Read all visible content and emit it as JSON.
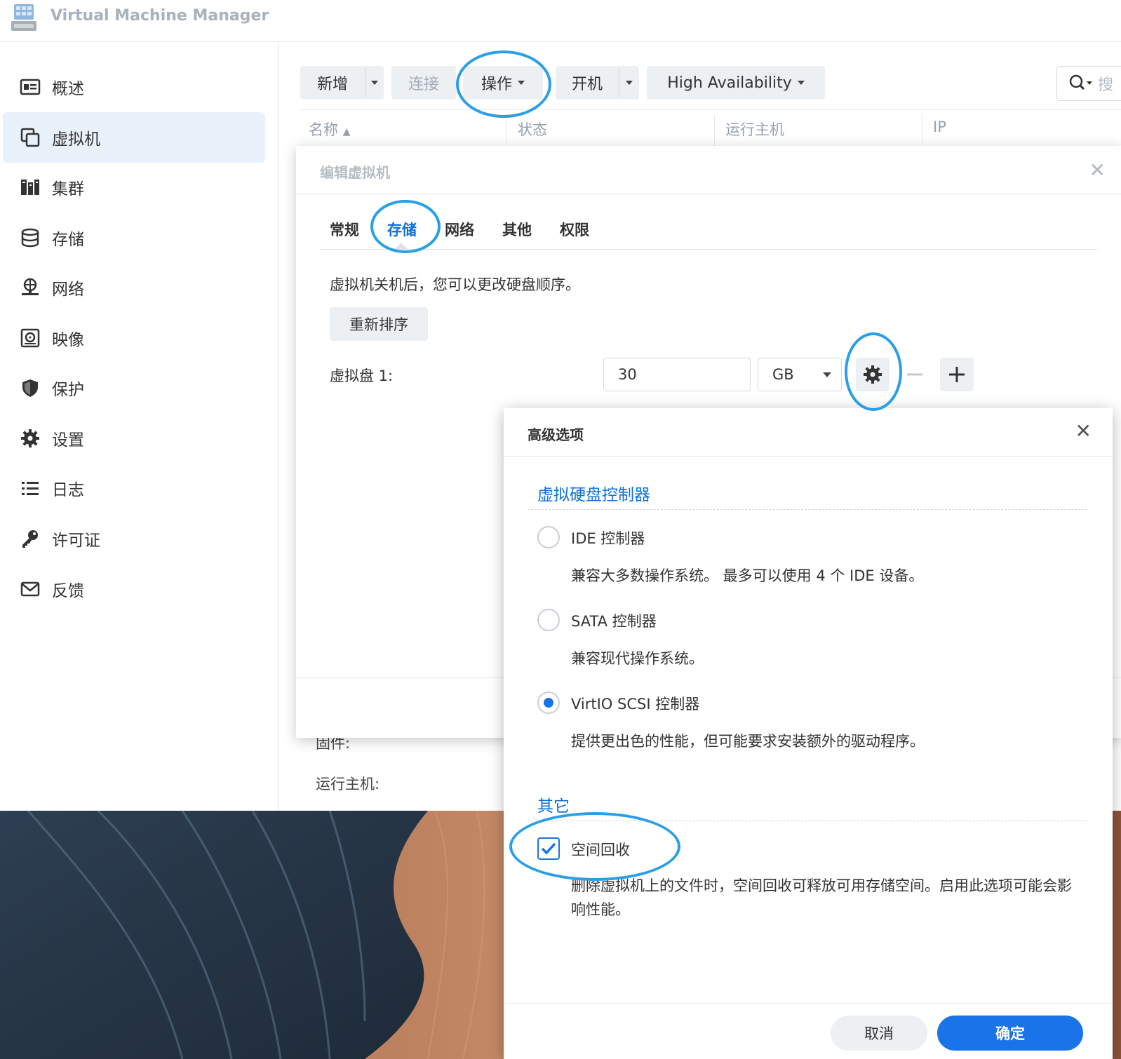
{
  "app": {
    "title": "Virtual Machine Manager"
  },
  "sidebar": {
    "items": [
      {
        "label": "概述",
        "icon": "overview-icon"
      },
      {
        "label": "虚拟机",
        "icon": "vm-icon",
        "active": true
      },
      {
        "label": "集群",
        "icon": "cluster-icon"
      },
      {
        "label": "存储",
        "icon": "storage-icon"
      },
      {
        "label": "网络",
        "icon": "network-icon"
      },
      {
        "label": "映像",
        "icon": "image-icon"
      },
      {
        "label": "保护",
        "icon": "shield-icon"
      },
      {
        "label": "设置",
        "icon": "gear-icon"
      },
      {
        "label": "日志",
        "icon": "log-icon"
      },
      {
        "label": "许可证",
        "icon": "key-icon"
      },
      {
        "label": "反馈",
        "icon": "mail-icon"
      }
    ]
  },
  "toolbar": {
    "create": "新增",
    "connect": "连接",
    "action": "操作",
    "power_on": "开机",
    "ha": "High Availability",
    "search_placeholder": "搜"
  },
  "grid": {
    "columns": [
      "名称",
      "状态",
      "运行主机",
      "IP"
    ]
  },
  "behind": {
    "firmware": "固件:",
    "host": "运行主机:"
  },
  "edit_dialog": {
    "title": "编辑虚拟机",
    "tabs": [
      "常规",
      "存储",
      "网络",
      "其他",
      "权限"
    ],
    "active_tab": "存储",
    "description": "虚拟机关机后，您可以更改硬盘顺序。",
    "reorder_button": "重新排序",
    "disk_label": "虚拟盘 1:",
    "disk_size": "30",
    "disk_unit": "GB"
  },
  "advanced_dialog": {
    "title": "高级选项",
    "section_controller": "虚拟硬盘控制器",
    "options": [
      {
        "label": "IDE 控制器",
        "desc": "兼容大多数操作系统。 最多可以使用 4 个 IDE 设备。",
        "selected": false
      },
      {
        "label": "SATA 控制器",
        "desc": "兼容现代操作系统。",
        "selected": false
      },
      {
        "label": "VirtIO SCSI 控制器",
        "desc": "提供更出色的性能，但可能要求安装额外的驱动程序。",
        "selected": true
      }
    ],
    "section_other": "其它",
    "reclaim_label": "空间回收",
    "reclaim_checked": true,
    "reclaim_desc": "删除虚拟机上的文件时，空间回收可释放可用存储空间。启用此选项可能会影响性能。",
    "cancel": "取消",
    "ok": "确定"
  },
  "colors": {
    "accent": "#1a73e8",
    "annotation": "#2a9fe6"
  }
}
